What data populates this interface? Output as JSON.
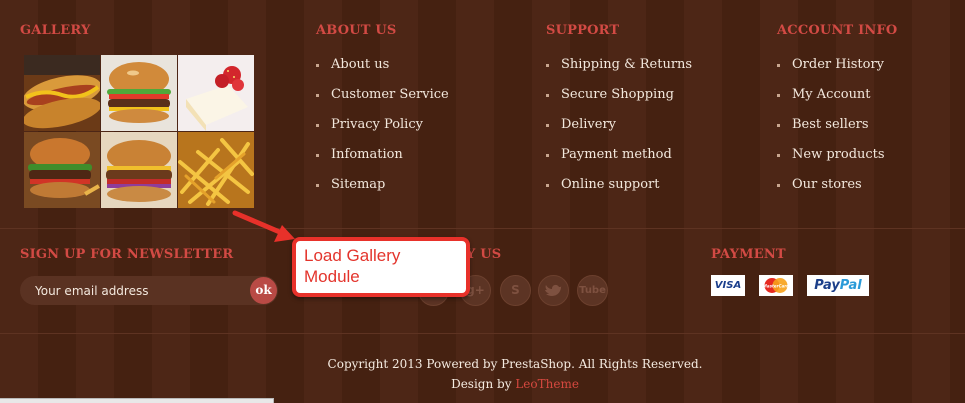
{
  "gallery": {
    "title": "GALLERY",
    "tiles": [
      {
        "icon": "hotdog-photo"
      },
      {
        "icon": "burger-photo"
      },
      {
        "icon": "strawberry-cake-photo"
      },
      {
        "icon": "burger-photo"
      },
      {
        "icon": "burger-photo"
      },
      {
        "icon": "fries-photo"
      }
    ]
  },
  "about": {
    "title": "ABOUT US",
    "links": [
      "About us",
      "Customer Service",
      "Privacy Policy",
      "Infomation",
      "Sitemap"
    ]
  },
  "support": {
    "title": "SUPPORT",
    "links": [
      "Shipping & Returns",
      "Secure Shopping",
      "Delivery",
      "Payment method",
      "Online support"
    ]
  },
  "account": {
    "title": "ACCOUNT INFO",
    "links": [
      "Order History",
      "My Account",
      "Best sellers",
      "New products",
      "Our stores"
    ]
  },
  "newsletter": {
    "title": "SIGN UP FOR NEWSLETTER",
    "placeholder": "Your email address",
    "submit_label": "ok"
  },
  "follow": {
    "title_visible": "Y US",
    "icons": [
      "facebook-icon",
      "google-plus-icon",
      "skype-icon",
      "twitter-icon",
      "youtube-icon"
    ],
    "youtube_label": "Tube"
  },
  "payment": {
    "title": "PAYMENT",
    "cards": [
      "VISA",
      "MasterCard",
      "PayPal"
    ]
  },
  "annotation": {
    "callout_text": "Load Gallery Module"
  },
  "footer": {
    "copyright": "Copyright 2013 Powered by PrestaShop. All Rights Reserved.",
    "design_prefix": "Design by",
    "design_brand": "LeoTheme"
  },
  "colors": {
    "background": "#4a2414",
    "heading": "#d24a44",
    "text": "#f3e8dd",
    "callout_border": "#e8312a"
  }
}
